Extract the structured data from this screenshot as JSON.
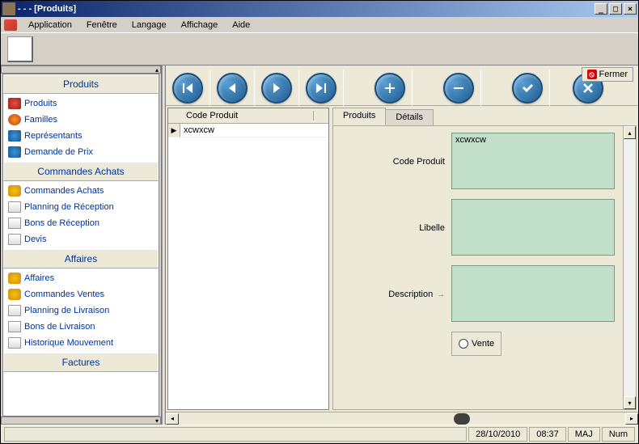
{
  "window": {
    "title": "- - - [Produits]"
  },
  "menu": {
    "items": [
      "Application",
      "Fenêtre",
      "Langage",
      "Affichage",
      "Aide"
    ]
  },
  "close_button": "Fermer",
  "sidebar": {
    "sections": [
      {
        "header": "Produits",
        "items": [
          "Produits",
          "Familles",
          "Représentants",
          "Demande de Prix"
        ]
      },
      {
        "header": "Commandes Achats",
        "items": [
          "Commandes Achats",
          "Planning de Réception",
          "Bons de Réception",
          "Devis"
        ]
      },
      {
        "header": "Affaires",
        "items": [
          "Affaires",
          "Commandes Ventes",
          "Planning de Livraison",
          "Bons de Livraison",
          "Historique Mouvement"
        ]
      },
      {
        "header": "Factures",
        "items": []
      }
    ]
  },
  "grid": {
    "header": "Code Produit",
    "rows": [
      "xcwxcw"
    ]
  },
  "tabs": {
    "items": [
      "Produits",
      "Détails"
    ],
    "active": 0
  },
  "form": {
    "code_produit": {
      "label": "Code Produit",
      "value": "xcwxcw"
    },
    "libelle": {
      "label": "Libelle",
      "value": ""
    },
    "description": {
      "label": "Description",
      "value": ""
    },
    "vente_label": "Vente"
  },
  "statusbar": {
    "date": "28/10/2010",
    "time": "08:37",
    "maj": "MAJ",
    "num": "Num"
  }
}
